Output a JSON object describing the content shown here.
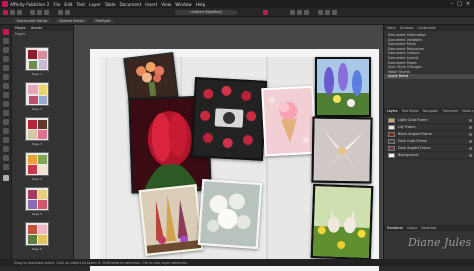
{
  "menu": {
    "app_name": "Affinity Publisher 2",
    "items": [
      "File",
      "Edit",
      "Text",
      "Layer",
      "Table",
      "Document",
      "Insert",
      "View",
      "Window",
      "Help"
    ]
  },
  "document_title": "Untitled (Modified)",
  "context": {
    "doc_setup": "Document Setup",
    "spread_setup": "Spread Setup",
    "preflight": "Preflight"
  },
  "pages_panel": {
    "tabs": [
      "Pages",
      "Assets"
    ],
    "section": "Pages",
    "labels": [
      "Page 1",
      "Page 2",
      "Page 3",
      "Page 4",
      "Page 5",
      "Page 6"
    ]
  },
  "right_panel": {
    "top_tabs": [
      "Stock",
      "Symbols",
      "Constraints"
    ],
    "panel_items": [
      "Document Information",
      "Document Variables",
      "Document Fonts",
      "Document Resources",
      "Document Colours",
      "Document Layout",
      "Document Pages",
      "Sync Style Changes",
      "Make Thumb",
      "Apply Bleed"
    ],
    "mid_tabs": [
      "Layers",
      "Text Styles",
      "Navigator",
      "Transform",
      "History"
    ],
    "layers": [
      {
        "name": "Light Grab Frame",
        "swatch": "#c9a46a"
      },
      {
        "name": "Lily Frame",
        "swatch": "#e9e2dc"
      },
      {
        "name": "Black Angled Frame",
        "swatch": "#7a2a2a"
      },
      {
        "name": "Dark Grab Frame",
        "swatch": "#444"
      },
      {
        "name": "Dark Angled Frame",
        "swatch": "#6b3b3b"
      },
      {
        "name": "Background",
        "swatch": "#ffffff"
      }
    ],
    "bottom_tabs": [
      "Transform",
      "Colour",
      "Swatches"
    ]
  },
  "status": {
    "text": "Drag to marquee select. Click an object to select it. Shift adds to selection. Ctrl to use Layer selection."
  },
  "watermark": "Diane Jules",
  "colors": {
    "accent": "#c2185b",
    "menubar": "#1e1e1e",
    "panel": "#333333"
  }
}
